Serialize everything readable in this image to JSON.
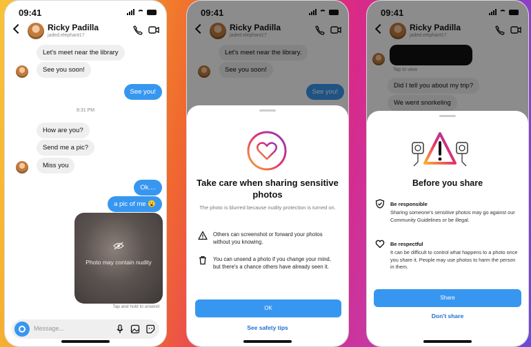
{
  "status": {
    "time": "09:41"
  },
  "contact": {
    "name": "Ricky Padilla",
    "username": "jaded.elephant17"
  },
  "phone1": {
    "messages": [
      {
        "dir": "in",
        "text": "Let's meet near the library"
      },
      {
        "dir": "in",
        "text": "See you soon!"
      },
      {
        "dir": "out",
        "text": "See you!"
      },
      {
        "dir": "in",
        "text": "How are you?"
      },
      {
        "dir": "in",
        "text": "Send me a pic?"
      },
      {
        "dir": "in",
        "text": "Miss you"
      },
      {
        "dir": "out",
        "text": "Ok...."
      },
      {
        "dir": "out",
        "text": "a pic of me 😮"
      }
    ],
    "timestamp": "8:31 PM",
    "blurred_caption": "Photo may contain nudity",
    "hint": "Tap and hold to unsend",
    "composer_placeholder": "Message..."
  },
  "phone2": {
    "messages": [
      {
        "dir": "in",
        "text": "Let's meet near the library."
      },
      {
        "dir": "in",
        "text": "See you soon!"
      },
      {
        "dir": "out",
        "text": "See you!"
      }
    ],
    "sheet": {
      "title": "Take care when sharing sensitive photos",
      "subtitle": "The photo is blurred because nudity protection is turned on.",
      "rows": [
        {
          "icon": "warning-triangle-icon",
          "text": "Others can screenshot or forward your photos without you knowing."
        },
        {
          "icon": "trash-icon",
          "text": "You can unsend a photo if you change your mind, but there's a chance others have already seen it."
        }
      ],
      "primary": "OK",
      "secondary": "See safety tips"
    }
  },
  "phone3": {
    "tap_to_view": "Tap to view",
    "messages": [
      {
        "dir": "in",
        "text": "Did I tell you about my trip?"
      },
      {
        "dir": "in",
        "text": "We went snorkeling"
      }
    ],
    "sheet": {
      "title": "Before you share",
      "items": [
        {
          "icon": "shield-check-icon",
          "heading": "Be responsible",
          "body": "Sharing someone's sensitive photos may go against our Community Guidelines or be illegal."
        },
        {
          "icon": "heart-icon",
          "heading": "Be respectful",
          "body": "It can be difficult to control what happens to a photo once you share it. People may use photos to harm the person in them."
        }
      ],
      "primary": "Share",
      "secondary": "Don't share"
    }
  },
  "colors": {
    "accent": "#3797f0",
    "link": "#1f6fd0"
  }
}
